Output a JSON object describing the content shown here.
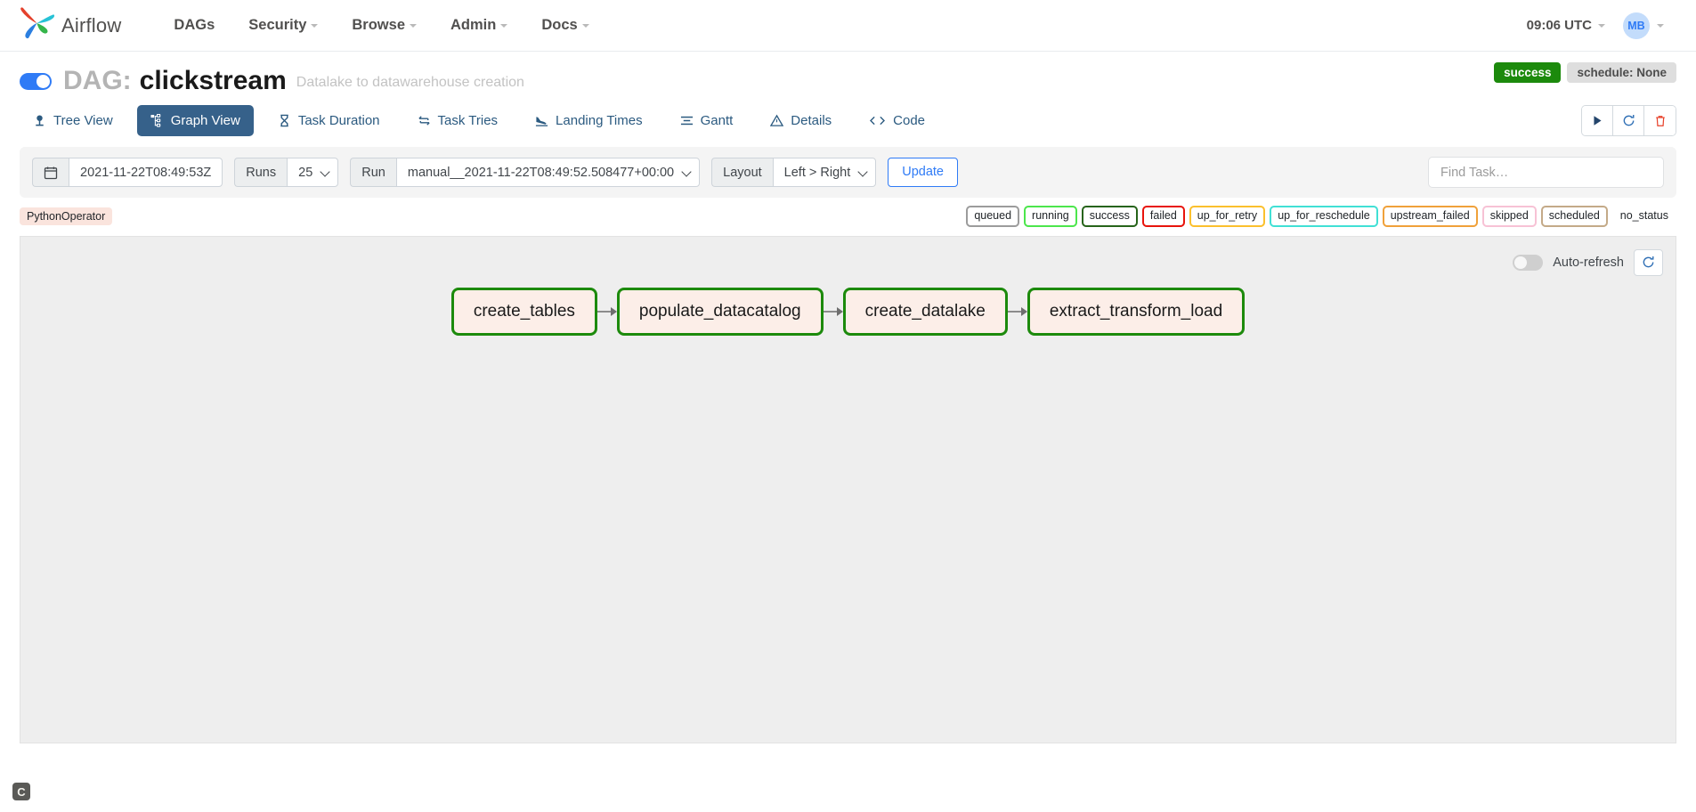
{
  "navbar": {
    "brand": "Airflow",
    "links": [
      {
        "label": "DAGs",
        "caret": false
      },
      {
        "label": "Security",
        "caret": true
      },
      {
        "label": "Browse",
        "caret": true
      },
      {
        "label": "Admin",
        "caret": true
      },
      {
        "label": "Docs",
        "caret": true
      }
    ],
    "time": "09:06 UTC",
    "avatar_initials": "MB"
  },
  "dag": {
    "toggle_on": true,
    "label": "DAG:",
    "name": "clickstream",
    "description": "Datalake to datawarehouse creation",
    "status_badge": "success",
    "schedule_badge": "schedule: None"
  },
  "tabs": [
    {
      "label": "Tree View",
      "icon": "tree-icon",
      "active": false
    },
    {
      "label": "Graph View",
      "icon": "graph-icon",
      "active": true
    },
    {
      "label": "Task Duration",
      "icon": "hourglass-icon",
      "active": false
    },
    {
      "label": "Task Tries",
      "icon": "retry-icon",
      "active": false
    },
    {
      "label": "Landing Times",
      "icon": "landing-icon",
      "active": false
    },
    {
      "label": "Gantt",
      "icon": "gantt-icon",
      "active": false
    },
    {
      "label": "Details",
      "icon": "warning-icon",
      "active": false
    },
    {
      "label": "Code",
      "icon": "code-icon",
      "active": false
    }
  ],
  "tab_actions": [
    {
      "name": "trigger-dag-button",
      "icon": "play-icon",
      "color": "#24456b"
    },
    {
      "name": "refresh-dag-button",
      "icon": "refresh-icon",
      "color": "#2f6fb5"
    },
    {
      "name": "delete-dag-button",
      "icon": "trash-icon",
      "color": "#e8412a"
    }
  ],
  "toolbar": {
    "calendar_icon": "calendar-icon",
    "base_date": "2021-11-22T08:49:53Z",
    "runs_label": "Runs",
    "runs_value": "25",
    "run_label": "Run",
    "run_value": "manual__2021-11-22T08:49:52.508477+00:00",
    "layout_label": "Layout",
    "layout_value": "Left > Right",
    "update_label": "Update",
    "find_task_placeholder": "Find Task…"
  },
  "legend": {
    "operator": "PythonOperator",
    "statuses": [
      {
        "label": "queued",
        "color": "#9c9c9c"
      },
      {
        "label": "running",
        "color": "#4ce64c"
      },
      {
        "label": "success",
        "color": "#27641a"
      },
      {
        "label": "failed",
        "color": "#e8140c"
      },
      {
        "label": "up_for_retry",
        "color": "#fbc02d"
      },
      {
        "label": "up_for_reschedule",
        "color": "#41e0d5"
      },
      {
        "label": "upstream_failed",
        "color": "#f0a13a"
      },
      {
        "label": "skipped",
        "color": "#f7c2d5"
      },
      {
        "label": "scheduled",
        "color": "#c4aa88"
      },
      {
        "label": "no_status",
        "color": "#ffffff"
      }
    ]
  },
  "graph": {
    "auto_refresh_label": "Auto-refresh",
    "auto_refresh_on": false,
    "refresh_icon": "refresh-icon",
    "nodes": [
      {
        "label": "create_tables"
      },
      {
        "label": "populate_datacatalog"
      },
      {
        "label": "create_datalake"
      },
      {
        "label": "extract_transform_load"
      }
    ]
  },
  "corner_widget": {
    "label": "C"
  }
}
